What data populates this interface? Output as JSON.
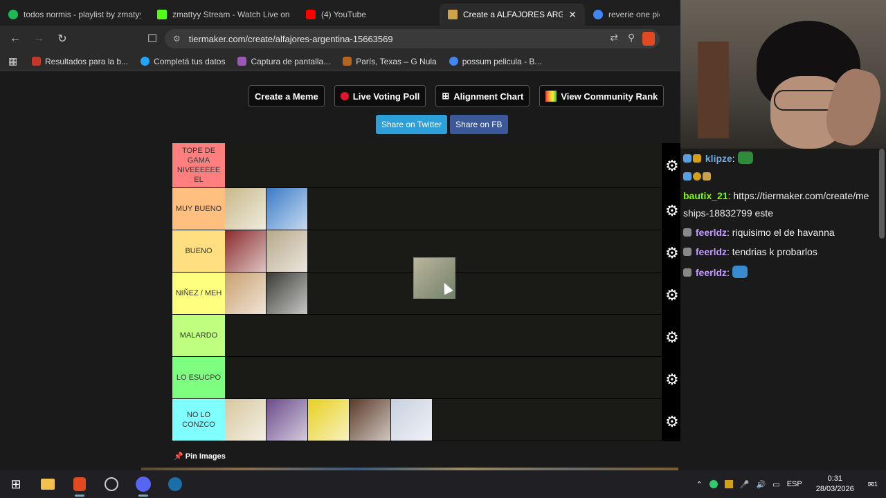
{
  "browser": {
    "tabs": [
      {
        "label": "todos normis - playlist by zmatyy",
        "color": "#1db954",
        "active": false
      },
      {
        "label": "zmattyy Stream - Watch Live on Ki",
        "color": "#53fc18",
        "active": false
      },
      {
        "label": "(4) YouTube",
        "color": "#ff0000",
        "active": false
      },
      {
        "label": "Create a ALFAJORES ARGENT",
        "color": "#cfa34a",
        "active": true
      },
      {
        "label": "reverie one piece",
        "color": "#4285f4",
        "active": false
      }
    ],
    "close_symbol": "✕",
    "url": "tiermaker.com/create/alfajores-argentina-15663569",
    "bookmarks": [
      {
        "label": "Resultados para la b...",
        "color": "#c0392b"
      },
      {
        "label": "Completá tus datos",
        "color": "#1ea7fd"
      },
      {
        "label": "Captura de pantalla...",
        "color": "#9b59b6"
      },
      {
        "label": "París, Texas – G Nula",
        "color": "#b5651d"
      },
      {
        "label": "possum pelicula - B...",
        "color": "#4285f4"
      }
    ]
  },
  "page": {
    "buttons": {
      "create_meme": "Create a Meme",
      "live_voting": "Live Voting Poll",
      "alignment": "Alignment Chart",
      "community": "View Community Rank"
    },
    "share": {
      "twitter": "Share on Twitter",
      "twitter_color": "#2d9fd9",
      "fb": "Share on FB",
      "fb_color": "#3b5998"
    },
    "tiers": [
      {
        "label": "TOPE DE GAMA NIVEEEEEE EL",
        "color": "#ff7f7f",
        "items": []
      },
      {
        "label": "MUY BUENO",
        "color": "#ffbf7f",
        "items": [
          "#c8b98a",
          "#3a7bc8"
        ]
      },
      {
        "label": "BUENO",
        "color": "#ffdf7f",
        "items": [
          "#8a2a2a",
          "#b8a88a"
        ]
      },
      {
        "label": "NIÑEZ / MEH",
        "color": "#ffff7f",
        "items": [
          "#c9a070",
          "#3a3a35"
        ]
      },
      {
        "label": "MALARDO",
        "color": "#bfff7f",
        "items": []
      },
      {
        "label": "LO ESUCPO",
        "color": "#7fff7f",
        "items": []
      },
      {
        "label": "NO LO CONZCO",
        "color": "#7fffff",
        "items": [
          "#d8c8a0",
          "#6a4a8a",
          "#e8d020",
          "#5a3a28",
          "#c8d0e0"
        ]
      }
    ],
    "pin_images": "Pin Images"
  },
  "chat": {
    "messages": [
      {
        "user": "klipze",
        "user_color": "#6fa8dc",
        "text": "",
        "emote": "#2e8b3a"
      },
      {
        "user": "",
        "user_color": "#ffffff",
        "text": "",
        "emote": ""
      },
      {
        "user": "bautix_21",
        "user_color": "#7cfc00",
        "text": "https://tiermaker.com/create/me",
        "emote": ""
      },
      {
        "user": "",
        "user_color": "#ffffff",
        "text": "ships-18832799 este",
        "emote": ""
      },
      {
        "user": "feerldz",
        "user_color": "#c39bff",
        "text": "riquisimo el de havanna",
        "emote": ""
      },
      {
        "user": "feerldz",
        "user_color": "#c39bff",
        "text": "tendrias k probarlos",
        "emote": ""
      },
      {
        "user": "feerldz",
        "user_color": "#c39bff",
        "text": "",
        "emote": "#3a8ad0"
      }
    ]
  },
  "taskbar": {
    "lang": "ESP",
    "time": "0:31",
    "date": "28/03/2026",
    "notif_count": "1"
  }
}
